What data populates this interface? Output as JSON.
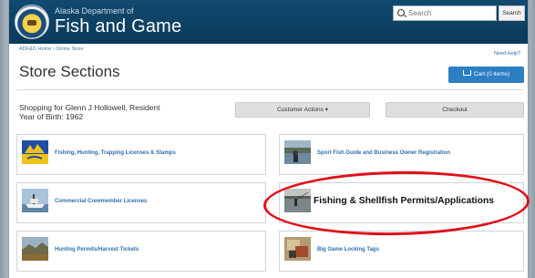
{
  "header": {
    "agency_top": "Alaska Department of",
    "agency_main": "Fish and Game",
    "search_placeholder": "Search",
    "search_button": "Search"
  },
  "breadcrumb": "ADF&G Home › Online Store",
  "need_help": "Need Help?",
  "page_title": "Store Sections",
  "cart_button": "Cart (0 items)",
  "shopper": {
    "line1": "Shopping for Glenn J Hollowell, Resident",
    "line2": "Year of Birth: 1962"
  },
  "customer_actions": "Customer Actions ▾",
  "checkout": "Checkout",
  "sections": [
    {
      "label": "Fishing, Hunting, Trapping Licenses & Stamps",
      "icon": "licenses-logo-icon"
    },
    {
      "label": "Sport Fish Guide and Business Owner Registration",
      "icon": "sport-fish-photo"
    },
    {
      "label": "Commercial Crewmember Licenses",
      "icon": "boat-photo"
    },
    {
      "label": "Fishing & Shellfish Permits/Applications",
      "icon": "fishing-photo"
    },
    {
      "label": "Hunting Permits/Harvest Tickets",
      "icon": "hunting-photo"
    },
    {
      "label": "Big Game Locking Tags",
      "icon": "tags-photo"
    }
  ],
  "colors": {
    "header": "#0b3a5b",
    "link": "#2f6fb0",
    "cart": "#2b7fc2",
    "highlight": "#e0101a"
  }
}
